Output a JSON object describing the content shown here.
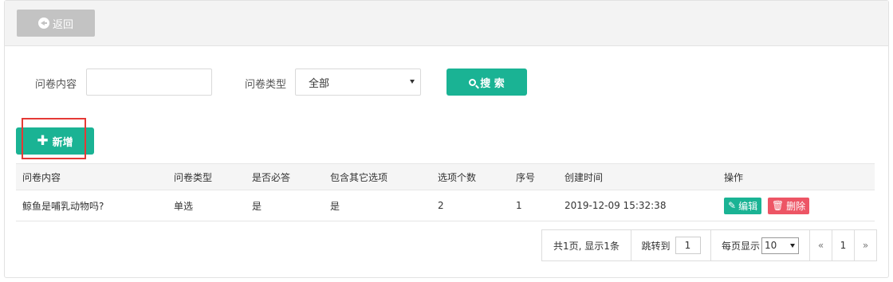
{
  "toolbar": {
    "back_label": "返回"
  },
  "filters": {
    "content_label": "问卷内容",
    "content_value": "",
    "type_label": "问卷类型",
    "type_selected": "全部",
    "search_label": "搜 索"
  },
  "actions": {
    "add_label": "新增"
  },
  "table": {
    "headers": [
      "问卷内容",
      "问卷类型",
      "是否必答",
      "包含其它选项",
      "选项个数",
      "序号",
      "创建时间",
      "操作"
    ],
    "rows": [
      {
        "content": "鲸鱼是哺乳动物吗?",
        "type": "单选",
        "required": "是",
        "other": "是",
        "option_count": "2",
        "order": "1",
        "created": "2019-12-09 15:32:38",
        "edit_label": "编辑",
        "delete_label": "删除"
      }
    ]
  },
  "pagination": {
    "summary": "共1页, 显示1条",
    "jump_label": "跳转到",
    "jump_value": "1",
    "page_size_label": "每页显示",
    "page_size_value": "10",
    "prev": "«",
    "current_page": "1",
    "next": "»"
  },
  "colors": {
    "primary": "#1ab394",
    "danger": "#ed5565",
    "back_button": "#c3c3c3",
    "highlight_box": "#e53935"
  }
}
